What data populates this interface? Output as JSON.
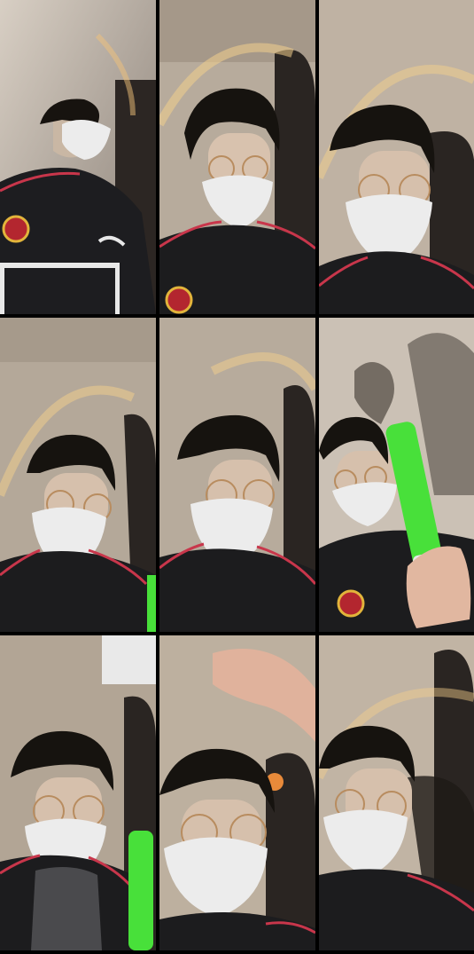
{
  "collage": {
    "rows": 3,
    "columns": 3,
    "tiles": [
      {
        "description_icon": "person-masked-looking-up-icon",
        "props": [
          "jersey-crest",
          "jersey-print"
        ]
      },
      {
        "description_icon": "person-masked-glasses-icon",
        "props": [
          "jersey-crest"
        ]
      },
      {
        "description_icon": "person-masked-glasses-icon",
        "props": []
      },
      {
        "description_icon": "person-masked-glasses-icon",
        "props": [
          "green-lightstick"
        ]
      },
      {
        "description_icon": "person-masked-glasses-icon",
        "props": []
      },
      {
        "description_icon": "person-masked-glasses-icon",
        "props": [
          "green-lightstick",
          "jersey-crest"
        ]
      },
      {
        "description_icon": "person-masked-glasses-icon",
        "props": [
          "green-lightstick"
        ]
      },
      {
        "description_icon": "person-masked-glasses-icon",
        "props": [
          "hand"
        ]
      },
      {
        "description_icon": "person-masked-glasses-icon",
        "props": []
      }
    ]
  },
  "colors": {
    "wall": "#b9ad9e",
    "shadow": "#2b2622",
    "hair": "#16130f",
    "mask": "#eaeaea",
    "shirt": "#1b1b1d",
    "stripe": "#c8364b",
    "lightstick": "#48e03a"
  }
}
